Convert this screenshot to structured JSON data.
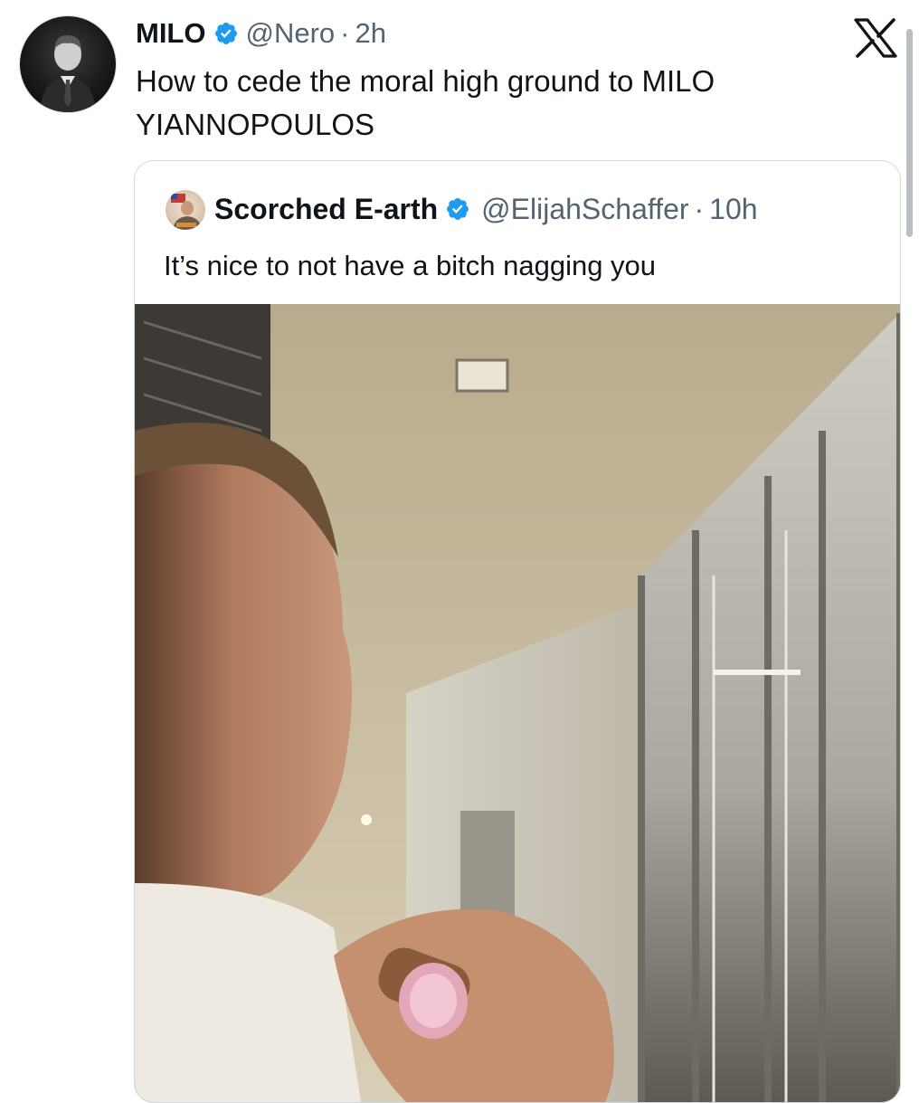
{
  "tweet": {
    "author_name": "MILO",
    "author_handle": "@Nero",
    "separator": "·",
    "time": "2h",
    "text": "How to cede the moral high ground to MILO YIANNOPOULOS",
    "verified_icon": "verified-badge-icon",
    "verified_color": "#1d9bf0"
  },
  "quoted_tweet": {
    "author_name": "Scorched E-arth",
    "author_handle": "@ElijahSchaffer",
    "separator": "·",
    "time": "10h",
    "text": "It’s nice to not have a bitch nagging you"
  },
  "brand_icon": "x-logo-icon",
  "colors": {
    "text": "#0f1419",
    "secondary_text": "#536471",
    "border": "#cfd9de"
  }
}
